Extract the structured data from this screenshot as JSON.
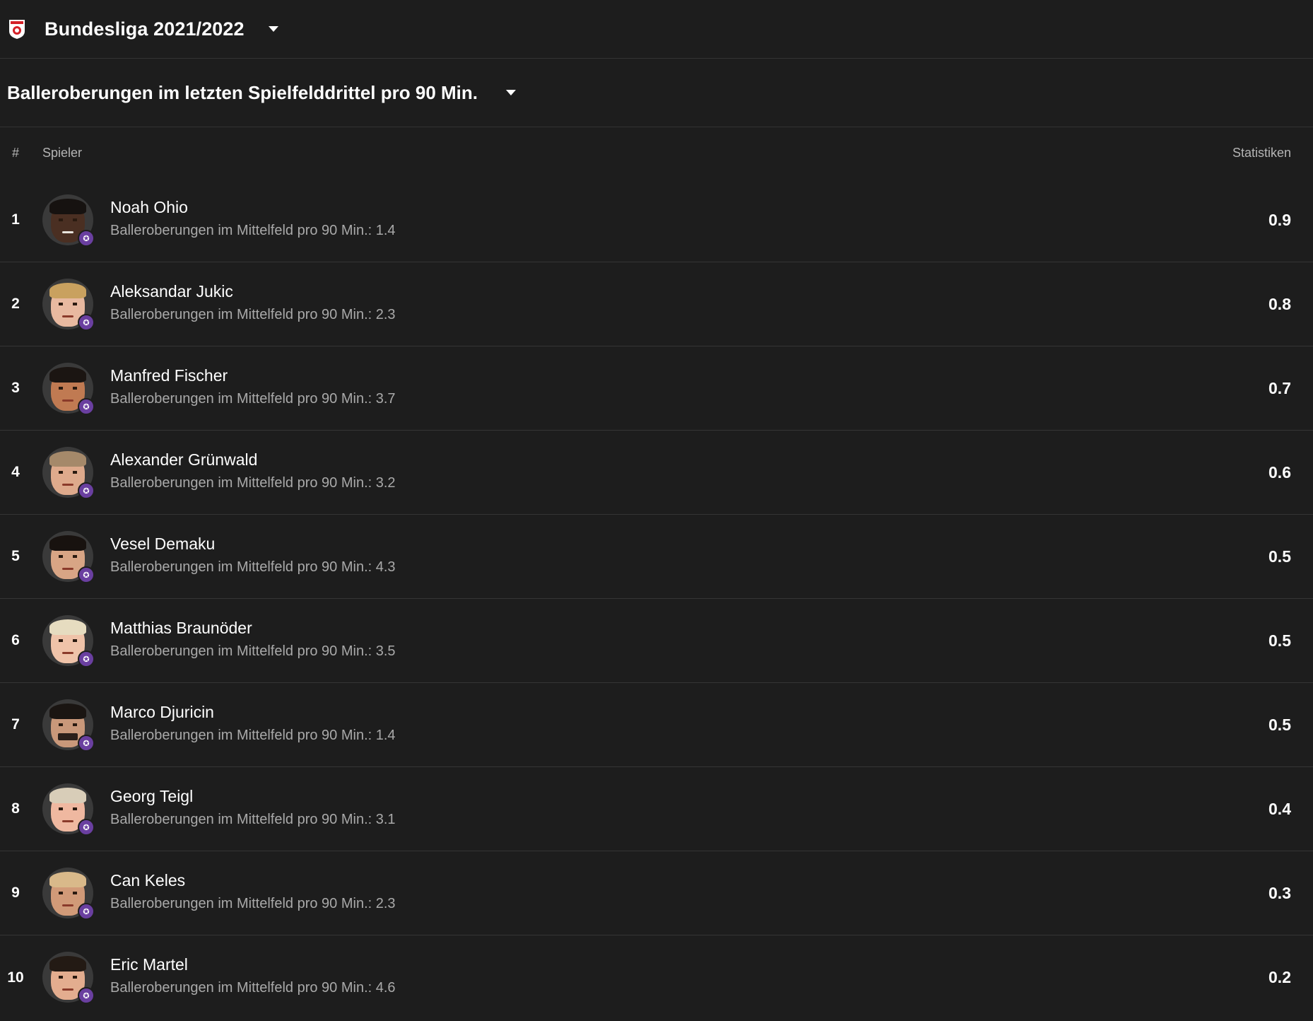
{
  "league": {
    "title": "Bundesliga 2021/2022",
    "logo_icon": "bundesliga-austria-logo-icon"
  },
  "stat": {
    "title": "Balleroberungen im letzten Spielfelddrittel pro 90 Min."
  },
  "columns": {
    "rank": "#",
    "player": "Spieler",
    "stats": "Statistiken"
  },
  "colors": {
    "background": "#1d1d1d",
    "divider": "#353535",
    "club_badge": "#6a3fa0"
  },
  "players": [
    {
      "rank": "1",
      "name": "Noah Ohio",
      "sub": "Balleroberungen im Mittelfeld pro 90 Min.: 1.4",
      "value": "0.9"
    },
    {
      "rank": "2",
      "name": "Aleksandar Jukic",
      "sub": "Balleroberungen im Mittelfeld pro 90 Min.: 2.3",
      "value": "0.8"
    },
    {
      "rank": "3",
      "name": "Manfred Fischer",
      "sub": "Balleroberungen im Mittelfeld pro 90 Min.: 3.7",
      "value": "0.7"
    },
    {
      "rank": "4",
      "name": "Alexander Grünwald",
      "sub": "Balleroberungen im Mittelfeld pro 90 Min.: 3.2",
      "value": "0.6"
    },
    {
      "rank": "5",
      "name": "Vesel Demaku",
      "sub": "Balleroberungen im Mittelfeld pro 90 Min.: 4.3",
      "value": "0.5"
    },
    {
      "rank": "6",
      "name": "Matthias Braunöder",
      "sub": "Balleroberungen im Mittelfeld pro 90 Min.: 3.5",
      "value": "0.5"
    },
    {
      "rank": "7",
      "name": "Marco Djuricin",
      "sub": "Balleroberungen im Mittelfeld pro 90 Min.: 1.4",
      "value": "0.5"
    },
    {
      "rank": "8",
      "name": "Georg Teigl",
      "sub": "Balleroberungen im Mittelfeld pro 90 Min.: 3.1",
      "value": "0.4"
    },
    {
      "rank": "9",
      "name": "Can Keles",
      "sub": "Balleroberungen im Mittelfeld pro 90 Min.: 2.3",
      "value": "0.3"
    },
    {
      "rank": "10",
      "name": "Eric Martel",
      "sub": "Balleroberungen im Mittelfeld pro 90 Min.: 4.6",
      "value": "0.2"
    }
  ]
}
